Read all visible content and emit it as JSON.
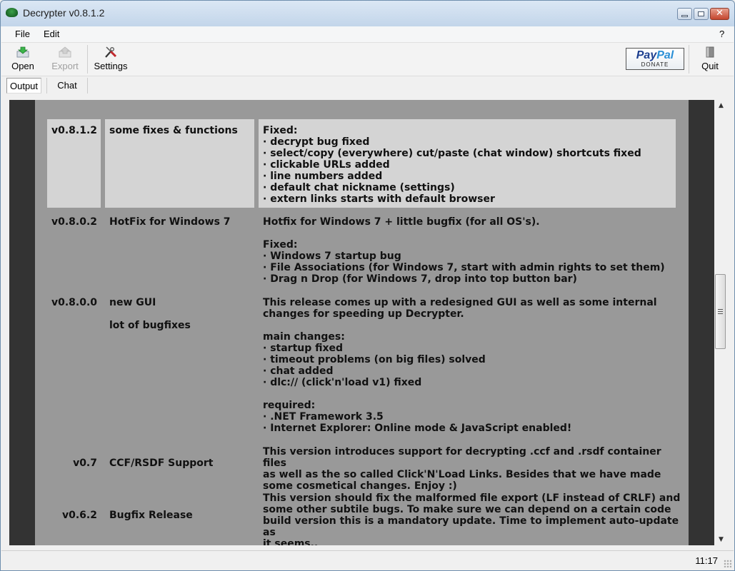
{
  "window": {
    "title": "Decrypter v0.8.1.2",
    "controls": {
      "minimize": "minimize",
      "maximize": "maximize",
      "close": "✕"
    }
  },
  "menu": {
    "items": [
      "File",
      "Edit"
    ],
    "help": "?"
  },
  "toolbar": {
    "open": "Open",
    "export": "Export",
    "settings": "Settings",
    "paypal_brand_a": "Pay",
    "paypal_brand_b": "Pal",
    "paypal_sub": "DONATE",
    "quit": "Quit"
  },
  "tabs": [
    {
      "label": "Output",
      "active": true
    },
    {
      "label": "Chat",
      "active": false
    }
  ],
  "changelog": [
    {
      "version": "v0.8.1.2",
      "title": "some fixes & functions",
      "subtitle": "",
      "description": "Fixed:\n· decrypt bug fixed\n· select/copy (everywhere) cut/paste (chat window) shortcuts fixed\n· clickable URLs added\n· line numbers added\n· default chat nickname (settings)\n· extern links starts with default browser",
      "highlighted": true
    },
    {
      "version": "v0.8.0.2",
      "title": "HotFix for Windows 7",
      "subtitle": "",
      "description": "Hotfix for Windows 7 + little bugfix (for all OS's).\n\nFixed:\n· Windows 7 startup bug\n· File Associations (for Windows 7, start with admin rights to set them)\n· Drag n Drop (for Windows 7, drop into top button bar)",
      "highlighted": false
    },
    {
      "version": "v0.8.0.0",
      "title": "new GUI",
      "subtitle": "lot of bugfixes",
      "description": "This release comes up with a redesigned GUI as well as some internal\nchanges for speeding up Decrypter.\n\nmain changes:\n· startup fixed\n· timeout problems (on big files) solved\n· chat added\n· dlc:// (click'n'load v1) fixed\n\nrequired:\n· .NET Framework 3.5\n· Internet Explorer: Online mode & JavaScript enabled!",
      "highlighted": false
    },
    {
      "version": "v0.7",
      "title": "CCF/RSDF Support",
      "subtitle": "",
      "description": "This version introduces support for decrypting .ccf and .rsdf container files\nas well as the so called Click'N'Load Links. Besides that we have made\nsome cosmetical changes. Enjoy :)",
      "highlighted": false
    },
    {
      "version": "v0.6.2",
      "title": "Bugfix Release",
      "subtitle": "",
      "description": "This version should fix the malformed file export (LF instead of CRLF) and\nsome other subtile bugs. To make sure we can depend on a certain code\nbuild version this is a mandatory update. Time to implement auto-update as\nit seems..",
      "highlighted": false
    }
  ],
  "scrollbar": {
    "up": "▲",
    "down": "▼",
    "position_fraction": 0.45
  },
  "statusbar": {
    "time": "11:17"
  },
  "colors": {
    "content_bg": "#999999",
    "side_bars": "#333333",
    "highlight_bg": "#d4d4d4",
    "text": "#111111"
  }
}
